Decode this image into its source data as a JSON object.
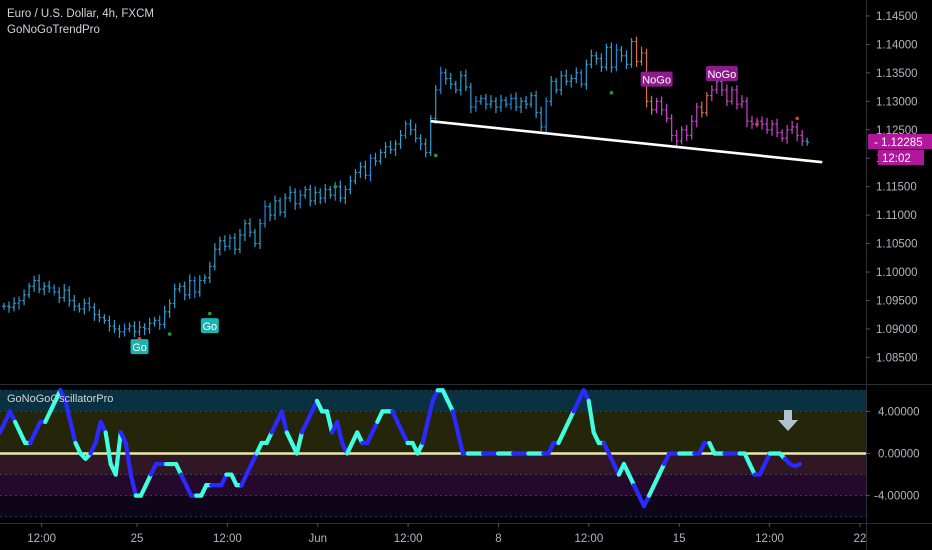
{
  "header": {
    "symbol_title": "Euro / U.S. Dollar, 4h, FXCM",
    "indicator_name": "GoNoGoTrendPro"
  },
  "oscillator": {
    "name": "GoNoGoOscillatorPro"
  },
  "labels": {
    "go": "Go",
    "nogo": "NoGo"
  },
  "price_badges": {
    "last_price": "1.12285",
    "countdown": "12:02"
  },
  "colors": {
    "background": "#000000",
    "go_bar": "#2f9fd0",
    "strong_go": "#1e88e5",
    "nogo_bar": "#cc44cc",
    "weak_nogo": "#e0703a",
    "trendline": "#ffffff",
    "go_label": "#19b3b0",
    "nogo_label": "#8e1a8e",
    "osc_line_dark": "#2a2aff",
    "osc_line_light": "#40ffe0",
    "osc_zero": "#e8e8b0",
    "arrow": "#b0c4d0"
  },
  "chart_data": [
    {
      "type": "candlestick",
      "title": "Euro / U.S. Dollar, 4h, FXCM",
      "y_ticks": [
        "1.14500",
        "1.14000",
        "1.13500",
        "1.13000",
        "1.12500",
        "1.12000",
        "1.11500",
        "1.11000",
        "1.10500",
        "1.10000",
        "1.09500",
        "1.09000",
        "1.08500"
      ],
      "ylim": [
        1.0805,
        1.1478
      ],
      "x_ticks": [
        "12:00",
        "25",
        "12:00",
        "Jun",
        "12:00",
        "8",
        "12:00",
        "15",
        "12:00",
        "22"
      ],
      "x_range_bars": [
        0,
        160
      ],
      "x_tick_positions_bars": [
        7.5,
        26.5,
        44.5,
        62.5,
        80.5,
        98.5,
        116.5,
        134.5,
        152.5,
        170.5
      ],
      "trendline": {
        "from": [
          85,
          1.1265
        ],
        "to": [
          163,
          1.1193
        ]
      },
      "go_labels": [
        {
          "bar": 27,
          "price": 1.0868
        },
        {
          "bar": 41,
          "price": 1.0905
        }
      ],
      "nogo_labels": [
        {
          "bar": 130,
          "price": 1.1338
        },
        {
          "bar": 143,
          "price": 1.1348
        }
      ],
      "last_price": 1.12285,
      "bars_close": [
        1.094,
        1.0938,
        1.0945,
        1.095,
        1.096,
        1.0975,
        1.0985,
        1.097,
        1.0975,
        1.0972,
        1.0965,
        1.0955,
        1.0968,
        1.095,
        1.094,
        1.0935,
        1.0945,
        1.0938,
        1.0925,
        1.092,
        1.0915,
        1.0905,
        1.09,
        1.0895,
        1.09,
        1.0905,
        1.0895,
        1.0903,
        1.09,
        1.091,
        1.0915,
        1.0908,
        1.093,
        1.0945,
        1.097,
        1.0975,
        1.096,
        1.0985,
        1.0965,
        1.0985,
        1.099,
        1.101,
        1.104,
        1.1055,
        1.1045,
        1.106,
        1.104,
        1.1065,
        1.1085,
        1.107,
        1.105,
        1.1085,
        1.1115,
        1.11,
        1.1125,
        1.1105,
        1.113,
        1.114,
        1.112,
        1.1135,
        1.1145,
        1.1125,
        1.114,
        1.113,
        1.1145,
        1.1135,
        1.115,
        1.113,
        1.1145,
        1.116,
        1.1175,
        1.1185,
        1.117,
        1.12,
        1.1195,
        1.121,
        1.122,
        1.1215,
        1.1225,
        1.124,
        1.126,
        1.125,
        1.1235,
        1.1225,
        1.121,
        1.127,
        1.132,
        1.135,
        1.134,
        1.133,
        1.132,
        1.1345,
        1.1325,
        1.129,
        1.13,
        1.1305,
        1.1295,
        1.13,
        1.129,
        1.1302,
        1.1295,
        1.1305,
        1.129,
        1.13,
        1.1295,
        1.131,
        1.128,
        1.1255,
        1.13,
        1.1335,
        1.132,
        1.1345,
        1.1335,
        1.134,
        1.135,
        1.133,
        1.1365,
        1.138,
        1.1375,
        1.136,
        1.1395,
        1.136,
        1.139,
        1.138,
        1.1365,
        1.1405,
        1.137,
        1.1385,
        1.13,
        1.1285,
        1.13,
        1.1285,
        1.127,
        1.124,
        1.123,
        1.125,
        1.124,
        1.1265,
        1.129,
        1.128,
        1.131,
        1.132,
        1.1335,
        1.132,
        1.13,
        1.132,
        1.1295,
        1.13,
        1.1265,
        1.126,
        1.1265,
        1.126,
        1.125,
        1.126,
        1.1245,
        1.1235,
        1.125,
        1.1255,
        1.124,
        1.123,
        1.1228
      ],
      "bar_states": "g=go, G=strong go, p=nogo, o=weak nogo (by index ranges)",
      "dots": [
        {
          "bar": 27,
          "price": 1.0883,
          "color": "#e53935"
        },
        {
          "bar": 33,
          "price": 1.0891,
          "color": "#1b9e3e"
        },
        {
          "bar": 41,
          "price": 1.0927,
          "color": "#1b9e3e"
        },
        {
          "bar": 66,
          "price": 1.115,
          "color": "#1b9e3e"
        },
        {
          "bar": 86,
          "price": 1.1205,
          "color": "#1b9e3e"
        },
        {
          "bar": 121,
          "price": 1.1315,
          "color": "#1b9e3e"
        },
        {
          "bar": 158,
          "price": 1.127,
          "color": "#e53935"
        },
        {
          "bar": 150,
          "price": 1.126,
          "color": "#e53935"
        }
      ]
    },
    {
      "type": "line",
      "title": "GoNoGoOscillatorPro",
      "y_ticks": [
        "4.00000",
        "0.00000",
        "-4.00000"
      ],
      "ylim": [
        -6.5,
        6.5
      ],
      "bands": [
        6,
        4,
        0,
        -2,
        -4,
        -6
      ],
      "values": [
        2,
        3,
        4,
        3,
        2,
        1,
        1,
        2,
        3,
        3,
        4,
        5,
        6,
        5,
        3,
        1,
        0,
        -0.5,
        0,
        1,
        3,
        2,
        -1,
        -2,
        2,
        1,
        -2,
        -4,
        -4,
        -3,
        -2,
        -1,
        -1,
        -1,
        -1,
        -1,
        -2,
        -3,
        -4,
        -4,
        -4,
        -3,
        -3,
        -3,
        -3,
        -2,
        -2,
        -3,
        -3,
        -2,
        -1,
        0,
        1,
        1,
        2,
        3,
        4,
        2,
        1,
        0,
        2,
        3,
        4,
        5,
        4,
        4,
        2,
        3,
        1,
        0,
        1,
        2,
        1,
        1,
        2,
        3,
        4,
        4,
        4,
        3,
        2,
        1,
        1,
        0,
        1,
        3,
        5,
        6,
        6,
        5,
        4,
        2,
        0,
        0,
        0,
        0,
        0,
        0,
        0,
        0,
        0,
        0,
        0,
        0,
        0,
        0,
        0,
        0,
        0,
        0,
        1,
        1,
        2,
        3,
        4,
        5,
        6,
        5,
        2,
        1,
        1,
        0,
        -1,
        -2,
        -1,
        -2,
        -3,
        -4,
        -5,
        -4,
        -3,
        -2,
        -1,
        0,
        0,
        0,
        0,
        0,
        0,
        0,
        1,
        1,
        0,
        0,
        0,
        0,
        0,
        0,
        0,
        -1,
        -2,
        -2,
        -1,
        0,
        0,
        0,
        -0.5,
        -1,
        -1.2,
        -1
      ],
      "line_color_changes": "alternates between dark blue and cyan segments"
    }
  ]
}
